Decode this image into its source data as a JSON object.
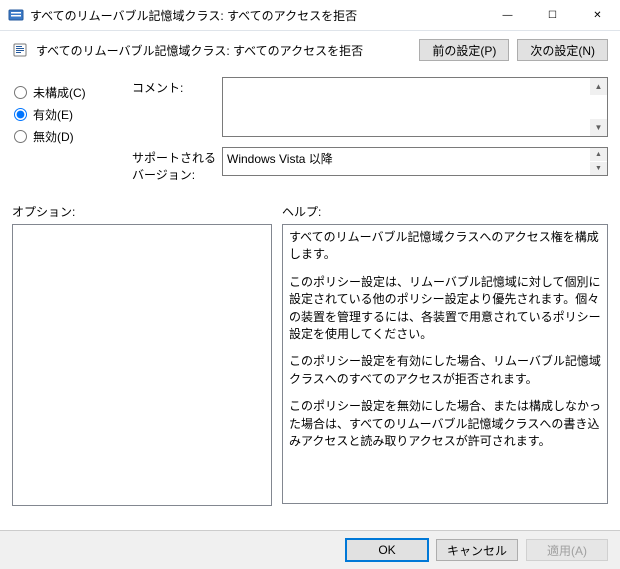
{
  "titlebar": {
    "title": "すべてのリムーバブル記憶域クラス: すべてのアクセスを拒否"
  },
  "policy": {
    "title": "すべてのリムーバブル記憶域クラス: すべてのアクセスを拒否"
  },
  "nav": {
    "prev": "前の設定(P)",
    "next": "次の設定(N)"
  },
  "radios": {
    "not_configured": "未構成(C)",
    "enabled": "有効(E)",
    "disabled": "無効(D)",
    "selected": "enabled"
  },
  "fields": {
    "comment_label": "コメント:",
    "comment_value": "",
    "supported_label": "サポートされるバージョン:",
    "supported_value": "Windows Vista 以降"
  },
  "sections": {
    "options_label": "オプション:",
    "help_label": "ヘルプ:"
  },
  "help": {
    "p1": "すべてのリムーバブル記憶域クラスへのアクセス権を構成します。",
    "p2": "このポリシー設定は、リムーバブル記憶域に対して個別に設定されている他のポリシー設定より優先されます。個々の装置を管理するには、各装置で用意されているポリシー設定を使用してください。",
    "p3": "このポリシー設定を有効にした場合、リムーバブル記憶域クラスへのすべてのアクセスが拒否されます。",
    "p4": "このポリシー設定を無効にした場合、または構成しなかった場合は、すべてのリムーバブル記憶域クラスへの書き込みアクセスと読み取りアクセスが許可されます。"
  },
  "buttons": {
    "ok": "OK",
    "cancel": "キャンセル",
    "apply": "適用(A)"
  },
  "glyphs": {
    "minimize": "—",
    "maximize": "☐",
    "close": "✕",
    "up": "▲",
    "down": "▼"
  }
}
